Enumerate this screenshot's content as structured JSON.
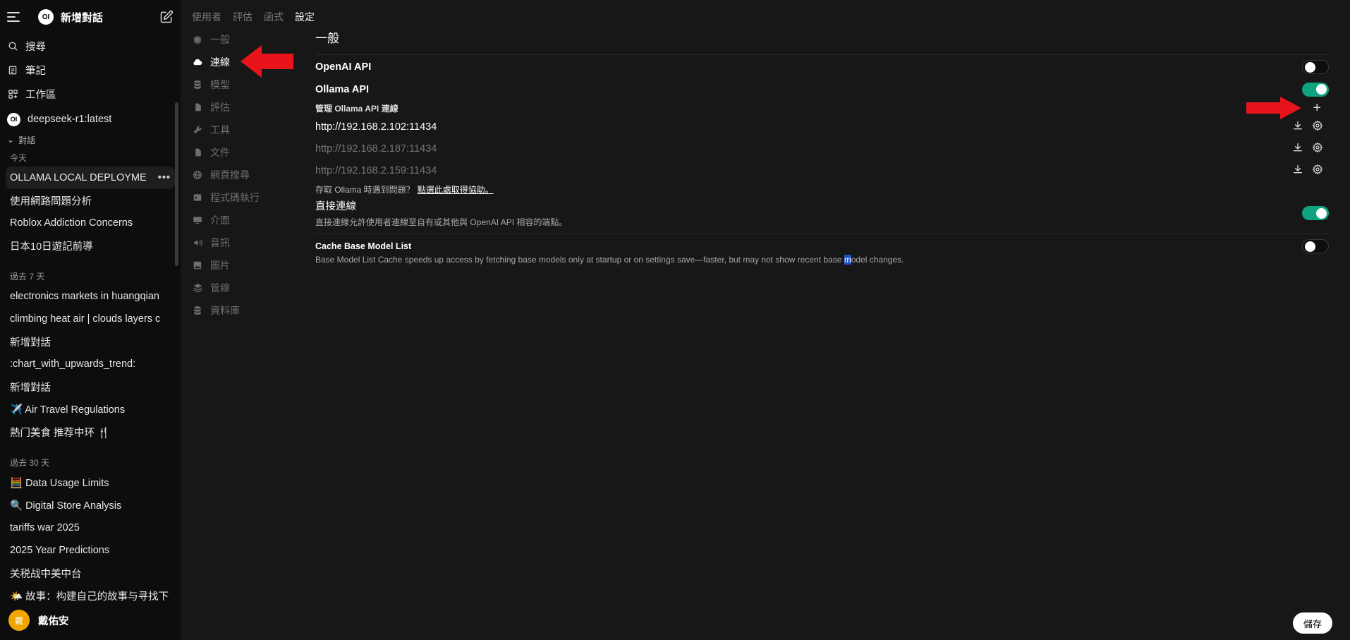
{
  "sidebar": {
    "new_chat": "新增對話",
    "search": "搜尋",
    "notes": "筆記",
    "workspace": "工作區",
    "model": "deepseek-r1:latest",
    "conversations_toggle": "對話",
    "logo_text": "OI",
    "groups": [
      {
        "label": "今天",
        "items": [
          "OLLAMA LOCAL DEPLOYME",
          "使用網路問題分析",
          "Roblox Addiction Concerns",
          "日本10日遊記前導"
        ]
      },
      {
        "label": "過去 7 天",
        "items": [
          "electronics markets in huangqian",
          "climbing heat air | clouds layers c",
          "新增對話",
          ":chart_with_upwards_trend:",
          "新增對話",
          "✈️ Air Travel Regulations",
          "熱门美食 推荐中环 🍴"
        ]
      },
      {
        "label": "過去 30 天",
        "items": [
          "🧮 Data Usage Limits",
          "🔍 Digital Store Analysis",
          "tariffs war 2025",
          "2025 Year Predictions",
          "关税战中美中台",
          "🌤️ 故事：构建自己的故事与寻找下"
        ]
      }
    ],
    "more_dots": "•••",
    "user": {
      "avatar": "戴",
      "name": "戴佑安"
    }
  },
  "tabs": [
    "使用者",
    "評估",
    "函式",
    "設定"
  ],
  "settings_nav": [
    "一般",
    "連線",
    "模型",
    "評估",
    "工具",
    "文件",
    "網頁搜尋",
    "程式碼執行",
    "介面",
    "音訊",
    "圖片",
    "管線",
    "資料庫"
  ],
  "main": {
    "title": "一般",
    "openai_label": "OpenAI API",
    "ollama_label": "Ollama API",
    "manage_label": "管理 Ollama API 連線",
    "urls": [
      "http://192.168.2.102:11434",
      "http://192.168.2.187:11434",
      "http://192.168.2.159:11434"
    ],
    "help_text": "存取 Ollama 時遇到問題？",
    "help_link": "點選此處取得協助。",
    "direct_label": "直接連線",
    "direct_desc": "直接連線允許使用者連線至自有或其他與 OpenAI API 相容的端點。",
    "cache_label": "Cache Base Model List",
    "cache_desc_a": "Base Model List Cache speeds up access by fetching base models only at startup or on settings save—faster, but may not show recent base ",
    "cache_desc_hl": "m",
    "cache_desc_b": "odel changes.",
    "plus": "+"
  },
  "save_label": "儲存",
  "colors": {
    "accent_green": "#10a37f",
    "arrow_red": "#e8141b",
    "bg": "#171717",
    "sidebar_bg": "#0d0d0d"
  }
}
